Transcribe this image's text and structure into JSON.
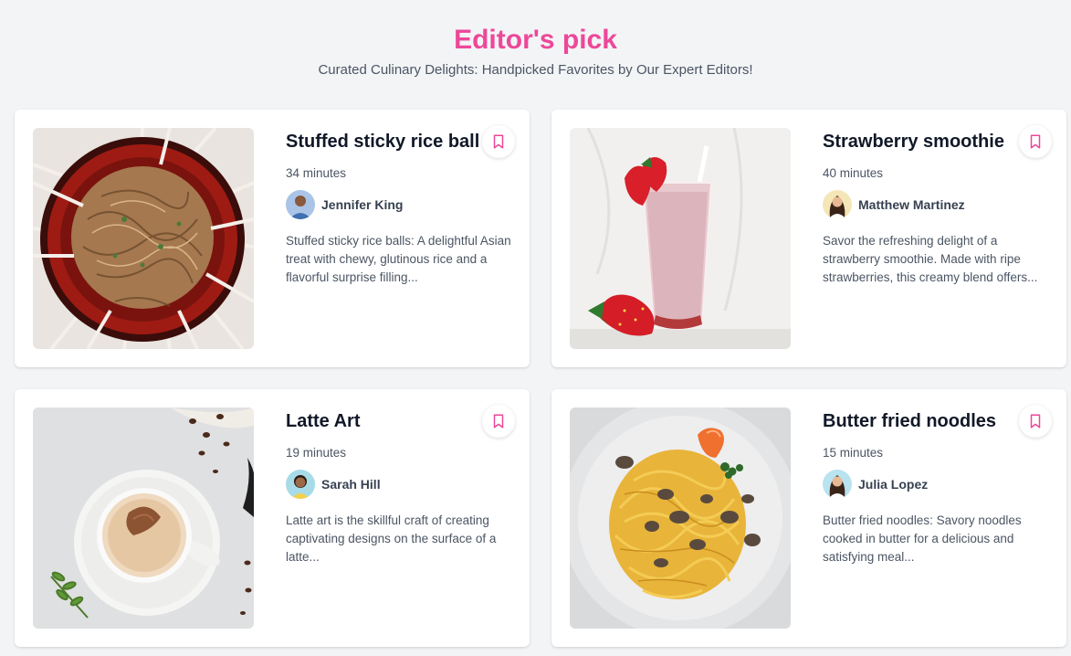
{
  "header": {
    "title": "Editor's pick",
    "subtitle": "Curated Culinary Delights: Handpicked Favorites by Our Expert Editors!"
  },
  "colors": {
    "accent": "#ec4899",
    "background": "#f3f4f6",
    "card": "#ffffff"
  },
  "cards": [
    {
      "title": "Stuffed sticky rice ball",
      "time": "34 minutes",
      "author": "Jennifer King",
      "description": "Stuffed sticky rice balls: A delightful Asian treat with chewy, glutinous rice and a flavorful surprise filling...",
      "image_icon": "noodle-bowl-image",
      "bookmark_icon": "bookmark-icon"
    },
    {
      "title": "Strawberry smoothie",
      "time": "40 minutes",
      "author": "Matthew Martinez",
      "description": "Savor the refreshing delight of a strawberry smoothie. Made with ripe strawberries, this creamy blend offers...",
      "image_icon": "smoothie-image",
      "bookmark_icon": "bookmark-icon"
    },
    {
      "title": "Latte Art",
      "time": "19 minutes",
      "author": "Sarah Hill",
      "description": "Latte art is the skillful craft of creating captivating designs on the surface of a latte...",
      "image_icon": "latte-image",
      "bookmark_icon": "bookmark-icon"
    },
    {
      "title": "Butter fried noodles",
      "time": "15 minutes",
      "author": "Julia Lopez",
      "description": "Butter fried noodles: Savory noodles cooked in butter for a delicious and satisfying meal...",
      "image_icon": "pasta-image",
      "bookmark_icon": "bookmark-icon"
    }
  ]
}
